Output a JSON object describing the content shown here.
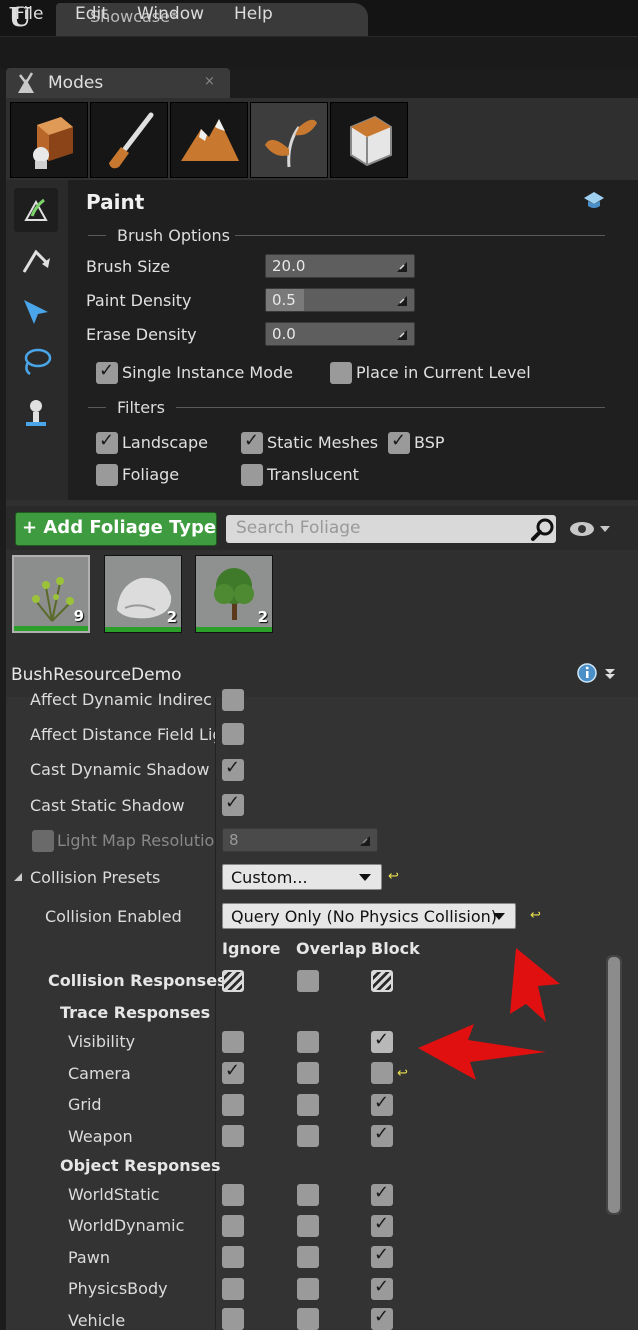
{
  "app": {
    "doc_tab": "Showcase*"
  },
  "menu": [
    "File",
    "Edit",
    "Window",
    "Help"
  ],
  "modes_tab": {
    "label": "Modes",
    "close": "×"
  },
  "mode_buttons": [
    "place-mode",
    "paint-mode",
    "landscape-mode",
    "foliage-mode",
    "geometry-mode"
  ],
  "tools": [
    "paint-tool",
    "reapply-tool",
    "select-tool",
    "lasso-tool",
    "fill-tool"
  ],
  "paint": {
    "title": "Paint",
    "brush_options": "Brush Options",
    "brush_size": {
      "label": "Brush Size",
      "value": "20.0"
    },
    "paint_density": {
      "label": "Paint Density",
      "value": "0.5",
      "fill": 0.26
    },
    "erase_density": {
      "label": "Erase Density",
      "value": "0.0"
    },
    "single_instance": {
      "label": "Single Instance Mode",
      "checked": true
    },
    "place_current": {
      "label": "Place in Current Level",
      "checked": false
    },
    "filters": "Filters",
    "filter_items": [
      {
        "label": "Landscape",
        "checked": true
      },
      {
        "label": "Static Meshes",
        "checked": true
      },
      {
        "label": "BSP",
        "checked": true
      },
      {
        "label": "Foliage",
        "checked": false
      },
      {
        "label": "Translucent",
        "checked": false
      }
    ]
  },
  "foliage_bar": {
    "add_button": "Add Foliage Type",
    "search_placeholder": "Search Foliage"
  },
  "foliage_types": [
    {
      "count": "9"
    },
    {
      "count": "2"
    },
    {
      "count": "2"
    }
  ],
  "details": {
    "asset_name": "BushResourceDemo",
    "affect_dynamic_indirect": "Affect Dynamic Indirect",
    "affect_distance_field": "Affect Distance Field Lighting",
    "cast_dynamic_shadow": "Cast Dynamic Shadow",
    "cast_static_shadow": "Cast Static Shadow",
    "light_map_resolution": {
      "label": "Light Map Resolution",
      "value": "8"
    },
    "collision_presets": {
      "label": "Collision Presets",
      "value": "Custom..."
    },
    "collision_enabled": {
      "label": "Collision Enabled",
      "value": "Query Only (No Physics Collision)"
    },
    "columns": [
      "Ignore",
      "Overlap",
      "Block"
    ],
    "collision_responses": "Collision Responses",
    "trace_responses": "Trace Responses",
    "trace_rows": [
      {
        "label": "Visibility",
        "state": "block-dim"
      },
      {
        "label": "Camera",
        "state": "ignore"
      },
      {
        "label": "Grid",
        "state": "block"
      },
      {
        "label": "Weapon",
        "state": "block"
      }
    ],
    "object_responses": "Object Responses",
    "object_rows": [
      {
        "label": "WorldStatic",
        "state": "block"
      },
      {
        "label": "WorldDynamic",
        "state": "block"
      },
      {
        "label": "Pawn",
        "state": "block"
      },
      {
        "label": "PhysicsBody",
        "state": "block"
      },
      {
        "label": "Vehicle",
        "state": "block"
      }
    ]
  },
  "colors": {
    "accent_green": "#3f9b3f",
    "annotation_red": "#e01010",
    "reset_yellow": "#e8e050"
  }
}
